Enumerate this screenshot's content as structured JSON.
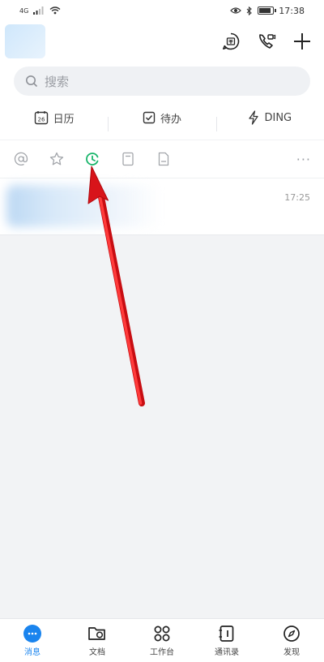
{
  "status_bar": {
    "network_label": "4G",
    "time": "17:38"
  },
  "header": {
    "icons": [
      "secret-chat-icon",
      "video-call-icon",
      "add-icon"
    ]
  },
  "search": {
    "placeholder": "搜索"
  },
  "quick_actions": [
    {
      "label": "日历",
      "icon": "calendar-icon",
      "icon_text": "26"
    },
    {
      "label": "待办",
      "icon": "todo-check-icon"
    },
    {
      "label": "DING",
      "icon": "lightning-icon"
    }
  ],
  "filters": {
    "icons": [
      "at-icon",
      "star-icon",
      "recent-clock-icon",
      "card-icon",
      "document-icon"
    ],
    "active_color": "#19b56b",
    "more": "···"
  },
  "conversations": [
    {
      "time": "17:25"
    }
  ],
  "tabbar": [
    {
      "label": "消息",
      "icon": "message-icon",
      "active": true
    },
    {
      "label": "文档",
      "icon": "folder-icon",
      "active": false
    },
    {
      "label": "工作台",
      "icon": "apps-icon",
      "active": false
    },
    {
      "label": "通讯录",
      "icon": "contacts-icon",
      "active": false
    },
    {
      "label": "发现",
      "icon": "discover-icon",
      "active": false
    }
  ],
  "colors": {
    "accent": "#1a84ee",
    "arrow": "#e8141b"
  }
}
